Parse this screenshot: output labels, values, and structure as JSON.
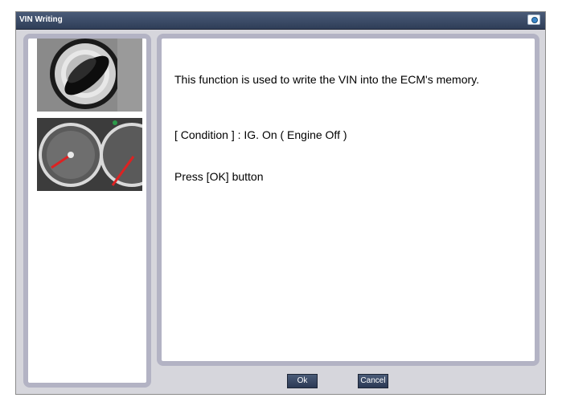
{
  "window": {
    "title": "VIN Writing"
  },
  "icons": {
    "capture": "camera-icon"
  },
  "images": [
    {
      "name": "ignition-key",
      "description_icon": "ignition-key-image"
    },
    {
      "name": "instrument-cluster",
      "description_icon": "gauge-cluster-image"
    }
  ],
  "message": {
    "line1": "This function is used to write the VIN into the ECM's memory.",
    "line2": "[ Condition ] : IG. On ( Engine Off )",
    "line3": "Press [OK] button"
  },
  "buttons": {
    "ok": "Ok",
    "cancel": "Cancel"
  },
  "colors": {
    "titlebar": "#3a4a66",
    "panel_border": "#b3b3c4",
    "window_bg": "#d6d6dc"
  }
}
